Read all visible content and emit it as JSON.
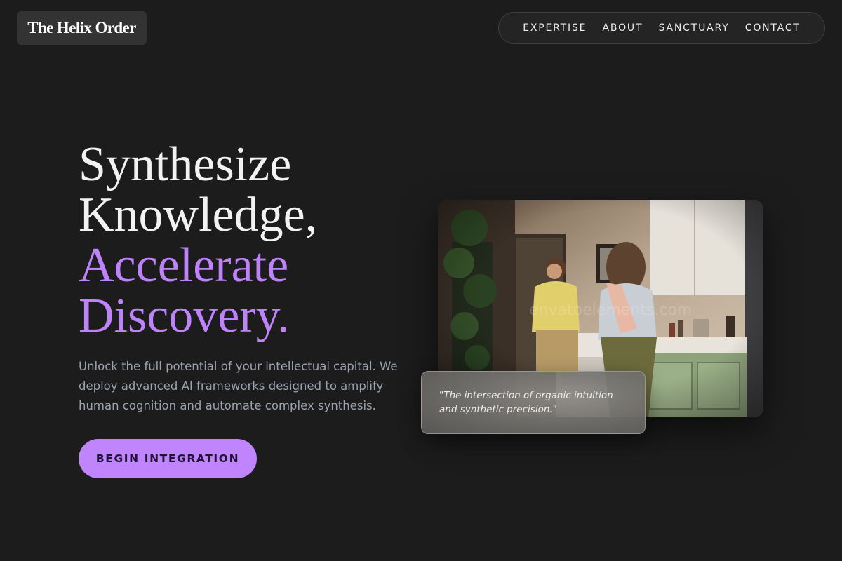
{
  "brand": {
    "name": "The Helix Order"
  },
  "nav": {
    "items": [
      {
        "label": "EXPERTISE"
      },
      {
        "label": "ABOUT"
      },
      {
        "label": "SANCTUARY"
      },
      {
        "label": "CONTACT"
      }
    ]
  },
  "hero": {
    "headline_line1": "Synthesize",
    "headline_line2": "Knowledge,",
    "headline_line3": "Accelerate",
    "headline_line4": "Discovery.",
    "description": "Unlock the full potential of your intellectual capital. We deploy advanced AI frameworks designed to amplify human cognition and automate complex synthesis.",
    "cta_label": "BEGIN INTEGRATION"
  },
  "feature": {
    "quote": "\"The intersection of organic intuition and synthetic precision.\""
  },
  "colors": {
    "background": "#1c1c1d",
    "accent": "#c084fc",
    "headline_accent": "#be83f8",
    "body_text": "#9ca3b0"
  }
}
